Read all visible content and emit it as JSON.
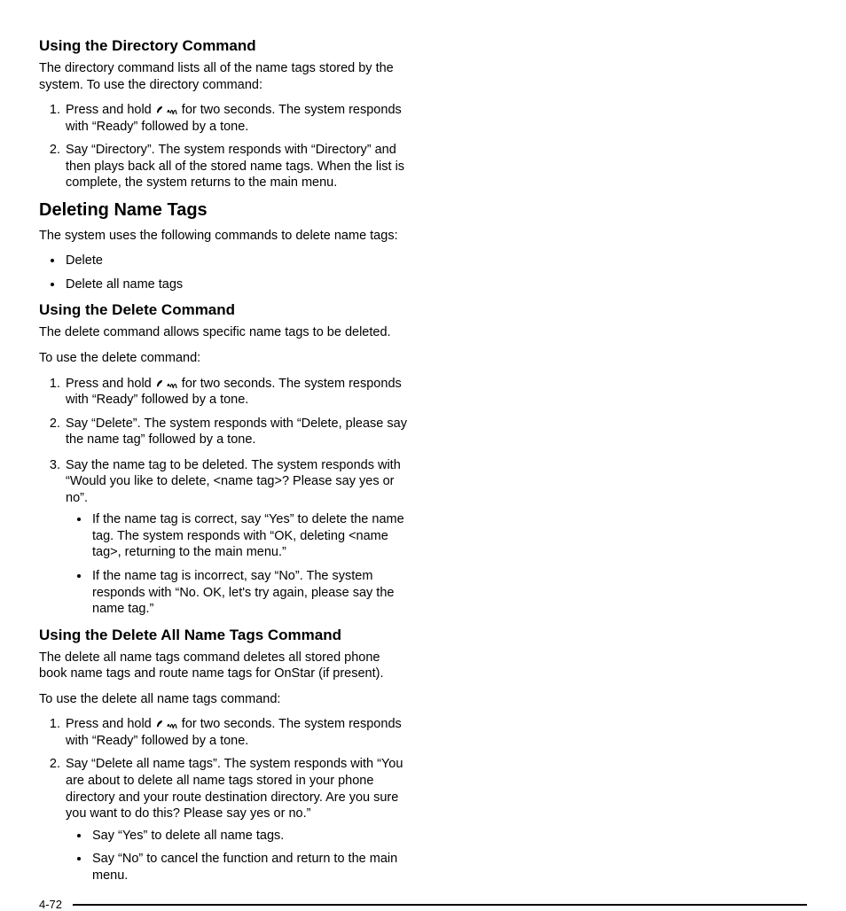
{
  "page_number": "4-72",
  "icons": {
    "phone_voice": "phone-voice-icon"
  },
  "col1": {
    "h_directory": "Using the Directory Command",
    "p_directory": "The directory command lists all of the name tags stored by the system. To use the directory command:",
    "ol_directory": [
      {
        "pre": "Press and hold ",
        "post": " for two seconds. The system responds with “Ready” followed by a tone."
      },
      {
        "full": "Say “Directory”. The system responds with “Directory” and then plays back all of the stored name tags. When the list is complete, the system returns to the main menu."
      }
    ],
    "h_deleting": "Deleting Name Tags",
    "p_deleting": "The system uses the following commands to delete name tags:",
    "ul_deleting": [
      "Delete",
      "Delete all name tags"
    ],
    "h_delete_cmd": "Using the Delete Command",
    "p_delete_cmd1": "The delete command allows specific name tags to be deleted.",
    "p_delete_cmd2": "To use the delete command:",
    "ol_delete_cmd": [
      {
        "pre": "Press and hold ",
        "post": " for two seconds. The system responds with “Ready” followed by a tone."
      },
      {
        "full": "Say “Delete”. The system responds with “Delete, please say the name tag” followed by a tone."
      }
    ]
  },
  "col2": {
    "ol_delete_cont": {
      "num3": "Say the name tag to be deleted. The system responds with “Would you like to delete, <name tag>? Please say yes or no”.",
      "sub": [
        "If the name tag is correct, say “Yes” to delete the name tag. The system responds with “OK, deleting <name tag>, returning to the main menu.”",
        "If the name tag is incorrect, say “No”. The system responds with “No. OK, let's try again, please say the name tag.”"
      ]
    },
    "h_delete_all": "Using the Delete All Name Tags Command",
    "p_delete_all1": "The delete all name tags command deletes all stored phone book name tags and route name tags for OnStar (if present).",
    "p_delete_all2": "To use the delete all name tags command:",
    "ol_delete_all": [
      {
        "pre": "Press and hold ",
        "post": " for two seconds. The system responds with “Ready” followed by a tone."
      },
      {
        "full": "Say “Delete all name tags”. The system responds with “You are about to delete all name tags stored in your phone directory and your route destination directory. Are you sure you want to do this? Please say yes or no.”",
        "sub": [
          "Say “Yes” to delete all name tags.",
          "Say “No” to cancel the function and return to the main menu."
        ]
      }
    ]
  }
}
